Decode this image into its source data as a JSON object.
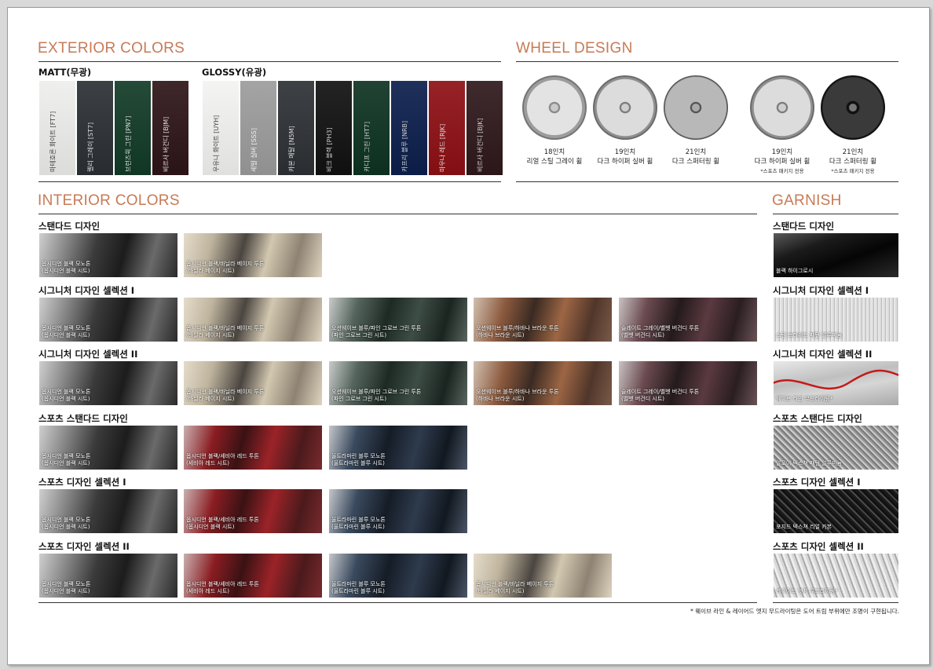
{
  "exterior": {
    "title": "EXTERIOR COLORS",
    "matt_label": "MATT(무광)",
    "glossy_label": "GLOSSY(유광)",
    "matt": [
      {
        "name": "마테호른 화이트 [FT7]",
        "color": "#eeeeed",
        "text": "#444"
      },
      {
        "name": "렐리 그레이 [ST7]",
        "color": "#2b3035",
        "text": "#ddd"
      },
      {
        "name": "브런즈윅 그린 [PN7]",
        "color": "#123b27",
        "text": "#ddd"
      },
      {
        "name": "비르사 버건디 [BJM]",
        "color": "#2e1518",
        "text": "#ddd"
      }
    ],
    "glossy": [
      {
        "name": "우유니 화이트 [UYH]",
        "color": "#f3f3f2",
        "text": "#444"
      },
      {
        "name": "세빌 실버 [SSS]",
        "color": "#9c9c9c",
        "text": "#eee"
      },
      {
        "name": "카본 메탈 [N5M]",
        "color": "#2e3135",
        "text": "#ddd"
      },
      {
        "name": "비크 블랙 [PH3]",
        "color": "#111112",
        "text": "#ccc"
      },
      {
        "name": "카디프 그린 [HT7]",
        "color": "#0e3322",
        "text": "#ccc"
      },
      {
        "name": "카프리 블루 [NRB]",
        "color": "#0c1f4c",
        "text": "#ccc"
      },
      {
        "name": "마우나 레드 [RJK]",
        "color": "#8d1014",
        "text": "#ddd"
      },
      {
        "name": "비르사 버건디 [BJK]",
        "color": "#2f181b",
        "text": "#ccc"
      }
    ]
  },
  "wheel": {
    "title": "WHEEL DESIGN",
    "items": [
      {
        "size": "18인치",
        "name": "리얼 스틸 그레이 휠",
        "note": "",
        "style": "grey"
      },
      {
        "size": "19인치",
        "name": "다크 하이퍼 실버 휠",
        "note": "",
        "style": "silver"
      },
      {
        "size": "21인치",
        "name": "다크 스퍼터링 휠",
        "note": "",
        "style": "dark"
      },
      {
        "size": "19인치",
        "name": "다크 하이퍼 실버 휠",
        "note": "*스포츠 패키지 전용",
        "style": "silver"
      },
      {
        "size": "21인치",
        "name": "다크 스퍼터링 휠",
        "note": "*스포츠 패키지 전용",
        "style": "black"
      }
    ]
  },
  "interior": {
    "title": "INTERIOR COLORS",
    "rows": [
      {
        "label": "스탠다드 디자인",
        "items": [
          {
            "l1": "옵시디언 블랙 모노톤",
            "l2": "(옵시디언 블랙 시트)",
            "tone": "black"
          },
          {
            "l1": "옵시디언 블랙/바닐라 베이지 투톤",
            "l2": "(바닐라 베이지 시트)",
            "tone": "beige"
          }
        ]
      },
      {
        "label": "시그니처 디자인 셀렉션 I",
        "items": [
          {
            "l1": "옵시디언 블랙 모노톤",
            "l2": "(옵시디언 블랙 시트)",
            "tone": "black"
          },
          {
            "l1": "옵시디언 블랙/바닐라 베이지 투톤",
            "l2": "(바닐라 베이지 시트)",
            "tone": "beige"
          },
          {
            "l1": "오션웨이브 블루/파인 그로브 그린 투톤",
            "l2": "(파인 그로브 그린 시트)",
            "tone": "green"
          },
          {
            "l1": "오션웨이브 블루/하바나 브라운 투톤",
            "l2": "(하바나 브라운 시트)",
            "tone": "brown"
          },
          {
            "l1": "슬레이트 그레이/벨벳 버건디 투톤",
            "l2": "(벨벳 버건디 시트)",
            "tone": "burgundy"
          }
        ]
      },
      {
        "label": "시그니처 디자인 셀렉션 II",
        "items": [
          {
            "l1": "옵시디언 블랙 모노톤",
            "l2": "(옵시디언 블랙 시트)",
            "tone": "black"
          },
          {
            "l1": "옵시디언 블랙/바닐라 베이지 투톤",
            "l2": "(바닐라 베이지 시트)",
            "tone": "beige"
          },
          {
            "l1": "오션웨이브 블루/파인 그로브 그린 투톤",
            "l2": "(파인 그로브 그린 시트)",
            "tone": "green"
          },
          {
            "l1": "오션웨이브 블루/하바나 브라운 투톤",
            "l2": "(하바나 브라운 시트)",
            "tone": "brown"
          },
          {
            "l1": "슬레이트 그레이/벨벳 버건디 투톤",
            "l2": "(벨벳 버건디 시트)",
            "tone": "burgundy"
          }
        ]
      },
      {
        "label": "스포츠 스탠다드 디자인",
        "items": [
          {
            "l1": "옵시디언 블랙 모노톤",
            "l2": "(옵시디언 블랙 시트)",
            "tone": "black"
          },
          {
            "l1": "옵시디언 블랙/세비아 레드 투톤",
            "l2": "(세비아 레드 시트)",
            "tone": "red"
          },
          {
            "l1": "울트라마린 블루 모노톤",
            "l2": "(울트라마린 블루 시트)",
            "tone": "blue"
          }
        ]
      },
      {
        "label": "스포츠 디자인 셀렉션 I",
        "items": [
          {
            "l1": "옵시디언 블랙 모노톤",
            "l2": "(옵시디언 블랙 시트)",
            "tone": "black"
          },
          {
            "l1": "옵시디언 블랙/세비아 레드 투톤",
            "l2": "(옵시디언 블랙 시트)",
            "tone": "red"
          },
          {
            "l1": "울트라마린 블루 모노톤",
            "l2": "(울트라마린 블루 시트)",
            "tone": "blue"
          }
        ]
      },
      {
        "label": "스포츠 디자인 셀렉션 II",
        "items": [
          {
            "l1": "옵시디언 블랙 모노톤",
            "l2": "(옵시디언 블랙 시트)",
            "tone": "black"
          },
          {
            "l1": "옵시디언 블랙/세비아 레드 투톤",
            "l2": "(세비아 레드 시트)",
            "tone": "red"
          },
          {
            "l1": "울트라마린 블루 모노톤",
            "l2": "(울트라마린 블루 시트)",
            "tone": "blue"
          },
          {
            "l1": "옵시디언 블랙/바닐라 베이지 투톤",
            "l2": "(바닐라 베이지 시트)",
            "tone": "beige"
          }
        ]
      }
    ]
  },
  "garnish": {
    "title": "GARNISH",
    "rows": [
      {
        "label": "스탠다드 디자인",
        "caption": "블랙 하이그로시",
        "tone": "gloss"
      },
      {
        "label": "시그니처 디자인 셀렉션 I",
        "caption": "스틴 브러쉬드 패턴 알루미늄",
        "tone": "brushed"
      },
      {
        "label": "시그니처 디자인 셀렉션 II",
        "caption": "웨이브 라인 무드라이팅*",
        "tone": "wave"
      },
      {
        "label": "스포츠 스탠다드 디자인",
        "caption": "알로이 텍스쳐 패턴 알루미늄",
        "tone": "alloy"
      },
      {
        "label": "스포츠 디자인 셀렉션 I",
        "caption": "포지드 텍스쳐 리얼 카본",
        "tone": "carbon"
      },
      {
        "label": "스포츠 디자인 셀렉션 II",
        "caption": "레이어드 엣지 무드라이팅*",
        "tone": "layered"
      }
    ]
  },
  "footnote": "* 웨이브 라인 & 레이어드 엣지 무드라이팅은 도어 트림 부위에만 조명이 구현됩니다."
}
